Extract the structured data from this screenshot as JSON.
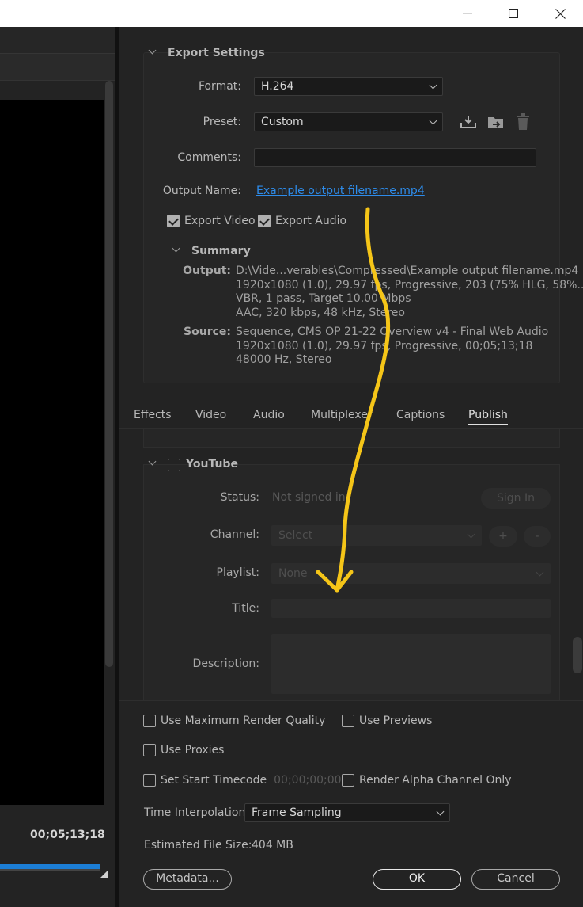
{
  "window": {
    "minimize_icon": "minimize-icon",
    "maximize_icon": "maximize-icon",
    "close_icon": "close-icon"
  },
  "preview": {
    "timecode": "00;05;13;18"
  },
  "export_settings": {
    "title": "Export Settings",
    "format_label": "Format:",
    "format_value": "H.264",
    "preset_label": "Preset:",
    "preset_value": "Custom",
    "comments_label": "Comments:",
    "comments_value": "",
    "output_name_label": "Output Name:",
    "output_name_value": "Example output filename.mp4",
    "export_video_label": "Export Video",
    "export_video_checked": true,
    "export_audio_label": "Export Audio",
    "export_audio_checked": true,
    "preset_icons": [
      "save-preset-icon",
      "import-preset-icon",
      "delete-preset-icon"
    ]
  },
  "summary": {
    "title": "Summary",
    "output_label": "Output:",
    "output_lines": [
      "D:\\Vide...verables\\Compressed\\Example output filename.mp4",
      "1920x1080 (1.0), 29.97 fps, Progressive, 203 (75% HLG, 58%...",
      "VBR, 1 pass, Target 10.00 Mbps",
      "AAC, 320 kbps, 48 kHz, Stereo"
    ],
    "source_label": "Source:",
    "source_lines": [
      "Sequence, CMS OP 21-22 Overview v4 - Final Web Audio",
      "1920x1080 (1.0), 29.97 fps, Progressive, 00;05;13;18",
      "48000 Hz, Stereo"
    ]
  },
  "tabs": [
    {
      "label": "Effects",
      "active": false
    },
    {
      "label": "Video",
      "active": false
    },
    {
      "label": "Audio",
      "active": false
    },
    {
      "label": "Multiplexer",
      "active": false
    },
    {
      "label": "Captions",
      "active": false
    },
    {
      "label": "Publish",
      "active": true
    }
  ],
  "youtube": {
    "title": "YouTube",
    "checked": false,
    "status_label": "Status:",
    "status_value": "Not signed in",
    "sign_in_label": "Sign In",
    "channel_label": "Channel:",
    "channel_value": "Select",
    "add_label": "+",
    "remove_label": "-",
    "playlist_label": "Playlist:",
    "playlist_value": "None",
    "title_label": "Title:",
    "title_value": "",
    "description_label": "Description:",
    "description_value": ""
  },
  "options": {
    "max_render_quality": "Use Maximum Render Quality",
    "use_previews": "Use Previews",
    "use_proxies": "Use Proxies",
    "set_start_timecode": "Set Start Timecode",
    "start_timecode_value": "00;00;00;00",
    "render_alpha_only": "Render Alpha Channel Only",
    "time_interpolation_label": "Time Interpolation:",
    "time_interpolation_value": "Frame Sampling",
    "estimated_size_label": "Estimated File Size:",
    "estimated_size_value": "404 MB"
  },
  "buttons": {
    "metadata": "Metadata...",
    "ok": "OK",
    "cancel": "Cancel"
  },
  "colors": {
    "link": "#2d8ceb",
    "annotation_arrow": "#f5c518",
    "timeline_progress": "#1c7ed6"
  }
}
